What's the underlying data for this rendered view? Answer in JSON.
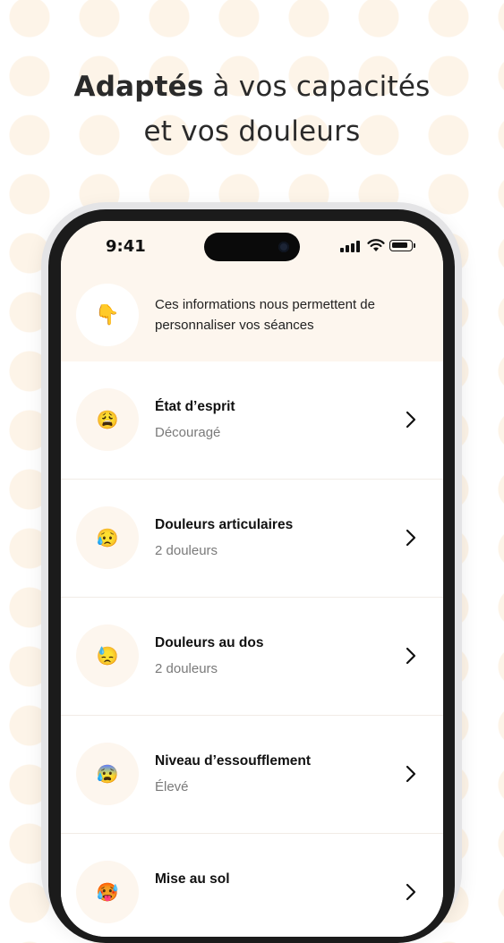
{
  "headline": {
    "bold": "Adaptés",
    "rest": " à vos capacités",
    "line2": "et vos douleurs"
  },
  "status_bar": {
    "time": "9:41"
  },
  "info": {
    "icon": "pointing-down-hand-emoji",
    "glyph": "👇",
    "text": "Ces informations nous permettent de personnaliser vos séances"
  },
  "items": [
    {
      "icon": "weary-face-emoji",
      "glyph": "😩",
      "title": "État d’esprit",
      "subtitle": "Découragé"
    },
    {
      "icon": "sad-sweat-face-emoji",
      "glyph": "😥",
      "title": "Douleurs articulaires",
      "subtitle": "2 douleurs"
    },
    {
      "icon": "downcast-sweat-face-emoji",
      "glyph": "😓",
      "title": "Douleurs au dos",
      "subtitle": "2 douleurs"
    },
    {
      "icon": "anxious-sweat-face-emoji",
      "glyph": "😰",
      "title": "Niveau d’essoufflement",
      "subtitle": "Élevé"
    },
    {
      "icon": "hot-face-emoji",
      "glyph": "🥵",
      "title": "Mise au sol",
      "subtitle": ""
    }
  ],
  "colors": {
    "cream": "#fdf6ee",
    "frame": "#1b1b1b",
    "text": "#111111",
    "muted": "#7a7a7a"
  }
}
